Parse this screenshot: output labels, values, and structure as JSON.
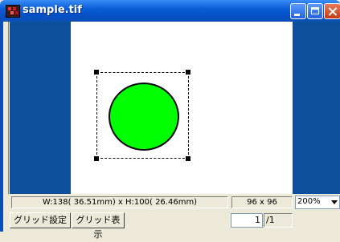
{
  "window": {
    "title": "sample.tif"
  },
  "status": {
    "size_text": "W:138( 36.51mm) x H:100( 26.46mm)",
    "resolution_text": "96 x 96",
    "zoom_value": "200%"
  },
  "toolbar": {
    "grid_settings_label": "グリッド設定",
    "grid_display_label": "グリッド表示"
  },
  "pager": {
    "current_page": "1",
    "total_pages": "/1"
  },
  "canvas": {
    "shape": "circle",
    "shape_fill": "#00ff00",
    "background": "#0d4f9a"
  },
  "icons": {
    "app": "image-file-icon",
    "minimize": "minimize-icon",
    "maximize": "maximize-icon",
    "close": "close-icon",
    "dropdown": "chevron-down-icon"
  }
}
